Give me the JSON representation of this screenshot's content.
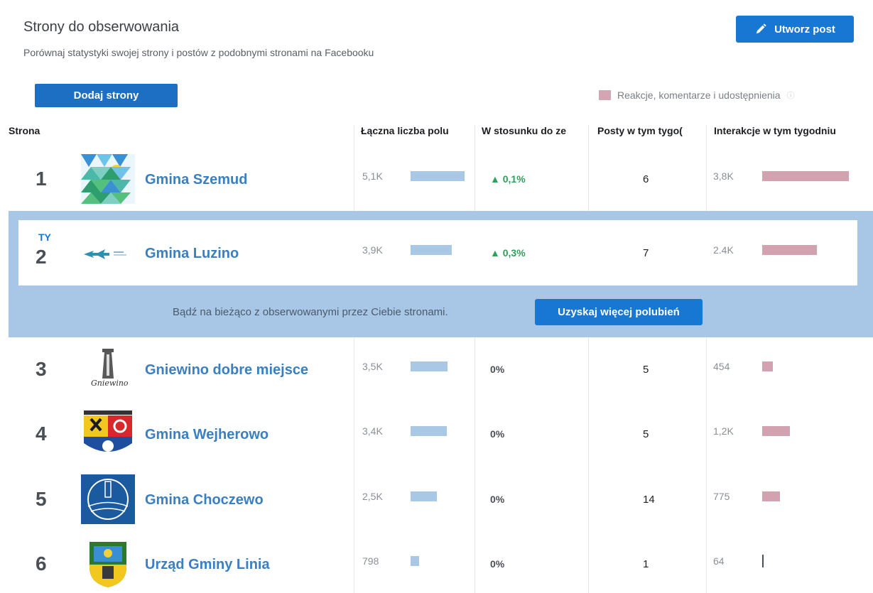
{
  "header": {
    "title": "Strony do obserwowania",
    "subtitle": "Porównaj statystyki swojej strony i postów z podobnymi stronami na Facebooku",
    "create_post": "Utworz post",
    "add_pages": "Dodaj strony",
    "legend": "Reakcje, komentarze i udostępnienia"
  },
  "columns": {
    "page": "Strona",
    "total_likes": "Łączna liczba polu",
    "vs_last_week": "W stosunku do ze",
    "posts_week": "Posty w tym tygo(",
    "engagement_week": "Interakcje w tym tygodniu"
  },
  "rows": [
    {
      "rank": "1",
      "you": "",
      "name": "Gmina Szemud",
      "likes": "5,1K",
      "likes_value": 5100,
      "change": "▲ 0,1%",
      "change_dir": "up",
      "posts": "6",
      "engagement": "3,8K",
      "engagement_value": 3800,
      "logo": "triangles-logo"
    },
    {
      "rank": "2",
      "you": "TY",
      "name": "Gmina Luzino",
      "likes": "3,9K",
      "likes_value": 3900,
      "change": "▲ 0,3%",
      "change_dir": "up",
      "posts": "7",
      "engagement": "2.4K",
      "engagement_value": 2400,
      "logo": "arrows-logo"
    },
    {
      "rank": "3",
      "you": "",
      "name": "Gniewino dobre miejsce",
      "likes": "3,5K",
      "likes_value": 3500,
      "change": "0%",
      "change_dir": "zero",
      "posts": "5",
      "engagement": "454",
      "engagement_value": 454,
      "logo": "tower-logo"
    },
    {
      "rank": "4",
      "you": "",
      "name": "Gmina Wejherowo",
      "likes": "3,4K",
      "likes_value": 3400,
      "change": "0%",
      "change_dir": "zero",
      "posts": "5",
      "engagement": "1,2K",
      "engagement_value": 1200,
      "logo": "coat-of-arms-logo"
    },
    {
      "rank": "5",
      "you": "",
      "name": "Gmina Choczewo",
      "likes": "2,5K",
      "likes_value": 2500,
      "change": "0%",
      "change_dir": "zero",
      "posts": "14",
      "engagement": "775",
      "engagement_value": 775,
      "logo": "lighthouse-logo"
    },
    {
      "rank": "6",
      "you": "",
      "name": "Urząd Gminy Linia",
      "likes": "798",
      "likes_value": 798,
      "change": "0%",
      "change_dir": "zero",
      "posts": "1",
      "engagement": "64",
      "engagement_value": 64,
      "logo": "shield-logo"
    }
  ],
  "promo": {
    "text": "Bądź na bieżąco z obserwowanymi przez Ciebie stronami.",
    "button": "Uzyskaj więcej polubień"
  },
  "colors": {
    "accent": "#1877d2",
    "likes_bar": "#a9c8e6",
    "engagement_bar": "#d3a2b0",
    "up": "#2e9e5e"
  }
}
